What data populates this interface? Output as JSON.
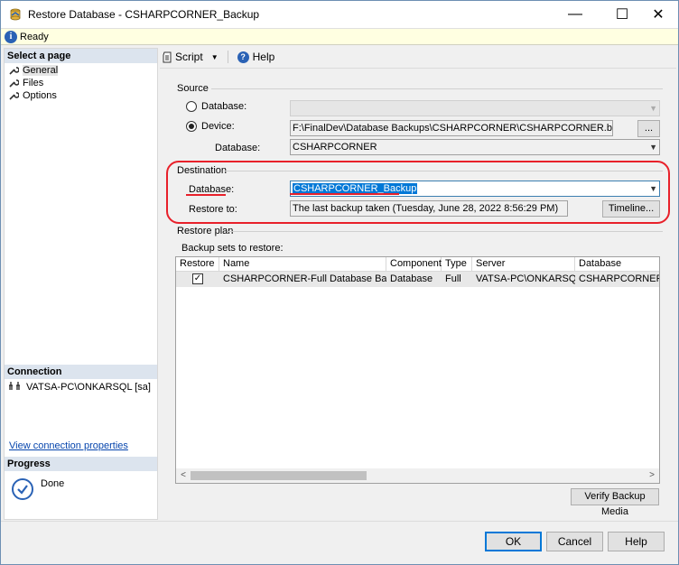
{
  "window": {
    "title": "Restore Database - CSHARPCORNER_Backup",
    "minimize_glyph": "—",
    "maximize_glyph": "☐",
    "close_glyph": "✕"
  },
  "status": {
    "icon_text": "i",
    "text": "Ready"
  },
  "left": {
    "select_page_header": "Select a page",
    "pages": [
      "General",
      "Files",
      "Options"
    ],
    "connection_header": "Connection",
    "connection_text": "VATSA-PC\\ONKARSQL [sa]",
    "view_connection_link": "View connection properties",
    "progress_header": "Progress",
    "progress_status": "Done"
  },
  "toolbar": {
    "script_label": "Script",
    "help_label": "Help"
  },
  "source": {
    "group_label": "Source",
    "database_radio_label": "Database:",
    "device_radio_label": "Device:",
    "device_path": "F:\\FinalDev\\Database Backups\\CSHARPCORNER\\CSHARPCORNER.bak",
    "browse_label": "...",
    "database_label": "Database:",
    "database_value": "CSHARPCORNER"
  },
  "destination": {
    "group_label": "Destination",
    "database_label": "Database:",
    "database_value": "CSHARPCORNER_Backup",
    "restore_to_label": "Restore to:",
    "restore_to_value": "The last backup taken (Tuesday, June 28, 2022 8:56:29 PM)",
    "timeline_label": "Timeline..."
  },
  "restore_plan": {
    "group_label": "Restore plan",
    "backup_sets_label": "Backup sets to restore:",
    "columns": [
      "Restore",
      "Name",
      "Component",
      "Type",
      "Server",
      "Database"
    ],
    "rows": [
      {
        "restore": true,
        "name": "CSHARPCORNER-Full Database Backup",
        "component": "Database",
        "type": "Full",
        "server": "VATSA-PC\\ONKARSQL",
        "database": "CSHARPCORNER"
      }
    ],
    "verify_label": "Verify Backup Media"
  },
  "footer": {
    "ok_label": "OK",
    "cancel_label": "Cancel",
    "help_label": "Help"
  },
  "colors": {
    "annotation_red": "#e8202a",
    "selection_blue": "#0078d7",
    "accent_blue": "#2a62b5"
  }
}
